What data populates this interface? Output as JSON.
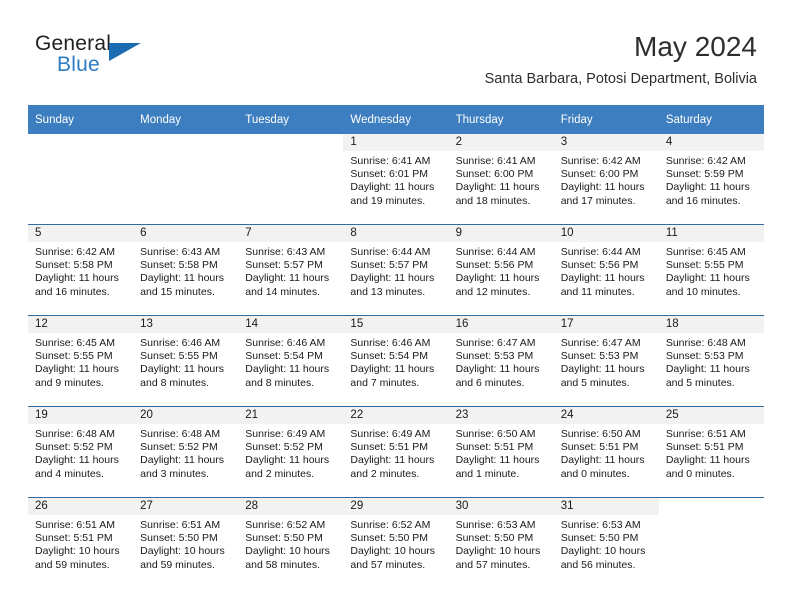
{
  "brand": {
    "word1": "General",
    "word2": "Blue",
    "flag_icon": "triangle-flag-icon",
    "accent_color": "#2b7cc2"
  },
  "header": {
    "month_title": "May 2024",
    "location": "Santa Barbara, Potosi Department, Bolivia"
  },
  "calendar": {
    "header_bg": "#3c7ebf",
    "daynum_bg": "#f2f2f2",
    "grid_line": "#2e6da4",
    "weekday_headers": [
      "Sunday",
      "Monday",
      "Tuesday",
      "Wednesday",
      "Thursday",
      "Friday",
      "Saturday"
    ],
    "weeks": [
      [
        {
          "blank": true
        },
        {
          "blank": true
        },
        {
          "blank": true
        },
        {
          "day": "1",
          "sunrise": "Sunrise: 6:41 AM",
          "sunset": "Sunset: 6:01 PM",
          "daylight_line1": "Daylight: 11 hours",
          "daylight_line2": "and 19 minutes."
        },
        {
          "day": "2",
          "sunrise": "Sunrise: 6:41 AM",
          "sunset": "Sunset: 6:00 PM",
          "daylight_line1": "Daylight: 11 hours",
          "daylight_line2": "and 18 minutes."
        },
        {
          "day": "3",
          "sunrise": "Sunrise: 6:42 AM",
          "sunset": "Sunset: 6:00 PM",
          "daylight_line1": "Daylight: 11 hours",
          "daylight_line2": "and 17 minutes."
        },
        {
          "day": "4",
          "sunrise": "Sunrise: 6:42 AM",
          "sunset": "Sunset: 5:59 PM",
          "daylight_line1": "Daylight: 11 hours",
          "daylight_line2": "and 16 minutes."
        }
      ],
      [
        {
          "day": "5",
          "sunrise": "Sunrise: 6:42 AM",
          "sunset": "Sunset: 5:58 PM",
          "daylight_line1": "Daylight: 11 hours",
          "daylight_line2": "and 16 minutes."
        },
        {
          "day": "6",
          "sunrise": "Sunrise: 6:43 AM",
          "sunset": "Sunset: 5:58 PM",
          "daylight_line1": "Daylight: 11 hours",
          "daylight_line2": "and 15 minutes."
        },
        {
          "day": "7",
          "sunrise": "Sunrise: 6:43 AM",
          "sunset": "Sunset: 5:57 PM",
          "daylight_line1": "Daylight: 11 hours",
          "daylight_line2": "and 14 minutes."
        },
        {
          "day": "8",
          "sunrise": "Sunrise: 6:44 AM",
          "sunset": "Sunset: 5:57 PM",
          "daylight_line1": "Daylight: 11 hours",
          "daylight_line2": "and 13 minutes."
        },
        {
          "day": "9",
          "sunrise": "Sunrise: 6:44 AM",
          "sunset": "Sunset: 5:56 PM",
          "daylight_line1": "Daylight: 11 hours",
          "daylight_line2": "and 12 minutes."
        },
        {
          "day": "10",
          "sunrise": "Sunrise: 6:44 AM",
          "sunset": "Sunset: 5:56 PM",
          "daylight_line1": "Daylight: 11 hours",
          "daylight_line2": "and 11 minutes."
        },
        {
          "day": "11",
          "sunrise": "Sunrise: 6:45 AM",
          "sunset": "Sunset: 5:55 PM",
          "daylight_line1": "Daylight: 11 hours",
          "daylight_line2": "and 10 minutes."
        }
      ],
      [
        {
          "day": "12",
          "sunrise": "Sunrise: 6:45 AM",
          "sunset": "Sunset: 5:55 PM",
          "daylight_line1": "Daylight: 11 hours",
          "daylight_line2": "and 9 minutes."
        },
        {
          "day": "13",
          "sunrise": "Sunrise: 6:46 AM",
          "sunset": "Sunset: 5:55 PM",
          "daylight_line1": "Daylight: 11 hours",
          "daylight_line2": "and 8 minutes."
        },
        {
          "day": "14",
          "sunrise": "Sunrise: 6:46 AM",
          "sunset": "Sunset: 5:54 PM",
          "daylight_line1": "Daylight: 11 hours",
          "daylight_line2": "and 8 minutes."
        },
        {
          "day": "15",
          "sunrise": "Sunrise: 6:46 AM",
          "sunset": "Sunset: 5:54 PM",
          "daylight_line1": "Daylight: 11 hours",
          "daylight_line2": "and 7 minutes."
        },
        {
          "day": "16",
          "sunrise": "Sunrise: 6:47 AM",
          "sunset": "Sunset: 5:53 PM",
          "daylight_line1": "Daylight: 11 hours",
          "daylight_line2": "and 6 minutes."
        },
        {
          "day": "17",
          "sunrise": "Sunrise: 6:47 AM",
          "sunset": "Sunset: 5:53 PM",
          "daylight_line1": "Daylight: 11 hours",
          "daylight_line2": "and 5 minutes."
        },
        {
          "day": "18",
          "sunrise": "Sunrise: 6:48 AM",
          "sunset": "Sunset: 5:53 PM",
          "daylight_line1": "Daylight: 11 hours",
          "daylight_line2": "and 5 minutes."
        }
      ],
      [
        {
          "day": "19",
          "sunrise": "Sunrise: 6:48 AM",
          "sunset": "Sunset: 5:52 PM",
          "daylight_line1": "Daylight: 11 hours",
          "daylight_line2": "and 4 minutes."
        },
        {
          "day": "20",
          "sunrise": "Sunrise: 6:48 AM",
          "sunset": "Sunset: 5:52 PM",
          "daylight_line1": "Daylight: 11 hours",
          "daylight_line2": "and 3 minutes."
        },
        {
          "day": "21",
          "sunrise": "Sunrise: 6:49 AM",
          "sunset": "Sunset: 5:52 PM",
          "daylight_line1": "Daylight: 11 hours",
          "daylight_line2": "and 2 minutes."
        },
        {
          "day": "22",
          "sunrise": "Sunrise: 6:49 AM",
          "sunset": "Sunset: 5:51 PM",
          "daylight_line1": "Daylight: 11 hours",
          "daylight_line2": "and 2 minutes."
        },
        {
          "day": "23",
          "sunrise": "Sunrise: 6:50 AM",
          "sunset": "Sunset: 5:51 PM",
          "daylight_line1": "Daylight: 11 hours",
          "daylight_line2": "and 1 minute."
        },
        {
          "day": "24",
          "sunrise": "Sunrise: 6:50 AM",
          "sunset": "Sunset: 5:51 PM",
          "daylight_line1": "Daylight: 11 hours",
          "daylight_line2": "and 0 minutes."
        },
        {
          "day": "25",
          "sunrise": "Sunrise: 6:51 AM",
          "sunset": "Sunset: 5:51 PM",
          "daylight_line1": "Daylight: 11 hours",
          "daylight_line2": "and 0 minutes."
        }
      ],
      [
        {
          "day": "26",
          "sunrise": "Sunrise: 6:51 AM",
          "sunset": "Sunset: 5:51 PM",
          "daylight_line1": "Daylight: 10 hours",
          "daylight_line2": "and 59 minutes."
        },
        {
          "day": "27",
          "sunrise": "Sunrise: 6:51 AM",
          "sunset": "Sunset: 5:50 PM",
          "daylight_line1": "Daylight: 10 hours",
          "daylight_line2": "and 59 minutes."
        },
        {
          "day": "28",
          "sunrise": "Sunrise: 6:52 AM",
          "sunset": "Sunset: 5:50 PM",
          "daylight_line1": "Daylight: 10 hours",
          "daylight_line2": "and 58 minutes."
        },
        {
          "day": "29",
          "sunrise": "Sunrise: 6:52 AM",
          "sunset": "Sunset: 5:50 PM",
          "daylight_line1": "Daylight: 10 hours",
          "daylight_line2": "and 57 minutes."
        },
        {
          "day": "30",
          "sunrise": "Sunrise: 6:53 AM",
          "sunset": "Sunset: 5:50 PM",
          "daylight_line1": "Daylight: 10 hours",
          "daylight_line2": "and 57 minutes."
        },
        {
          "day": "31",
          "sunrise": "Sunrise: 6:53 AM",
          "sunset": "Sunset: 5:50 PM",
          "daylight_line1": "Daylight: 10 hours",
          "daylight_line2": "and 56 minutes."
        },
        {
          "blank": true
        }
      ]
    ]
  }
}
